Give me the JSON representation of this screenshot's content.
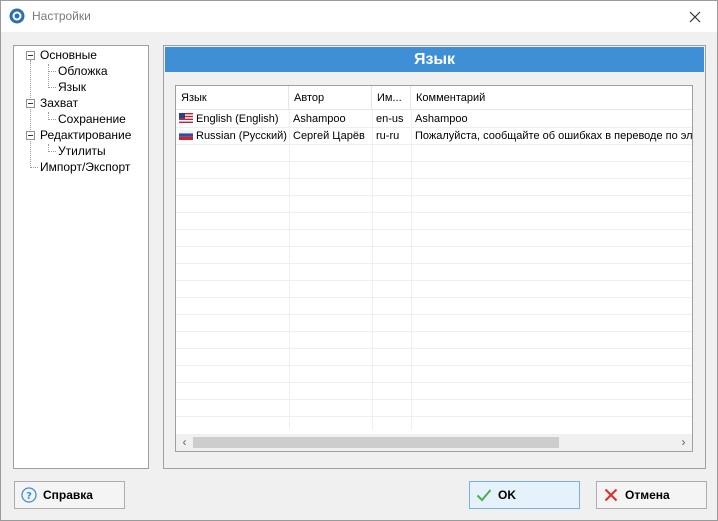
{
  "window": {
    "title": "Настройки"
  },
  "tree": {
    "items": [
      {
        "label": "Основные"
      },
      {
        "label": "Обложка"
      },
      {
        "label": "Язык"
      },
      {
        "label": "Захват"
      },
      {
        "label": "Сохранение"
      },
      {
        "label": "Редактирование"
      },
      {
        "label": "Утилиты"
      },
      {
        "label": "Импорт/Экспорт"
      }
    ]
  },
  "panel": {
    "header": "Язык"
  },
  "list": {
    "columns": [
      "Язык",
      "Автор",
      "Им...",
      "Комментарий"
    ],
    "rows": [
      {
        "flag": "us-flag",
        "language": "English (English)",
        "author": "Ashampoo",
        "code": "en-us",
        "comment": "Ashampoo"
      },
      {
        "flag": "ru-flag",
        "language": "Russian (Русский)",
        "author": "Сергей Царёв",
        "code": "ru-ru",
        "comment": "Пожалуйста, сообщайте об ошибках в переводе по эл"
      }
    ]
  },
  "buttons": {
    "help": "Справка",
    "ok": "OK",
    "cancel": "Отмена"
  },
  "colors": {
    "header_bg": "#3e8fd6",
    "ok_icon": "#4caf50",
    "cancel_icon": "#d9302c",
    "help_icon": "#3e8fd6"
  }
}
